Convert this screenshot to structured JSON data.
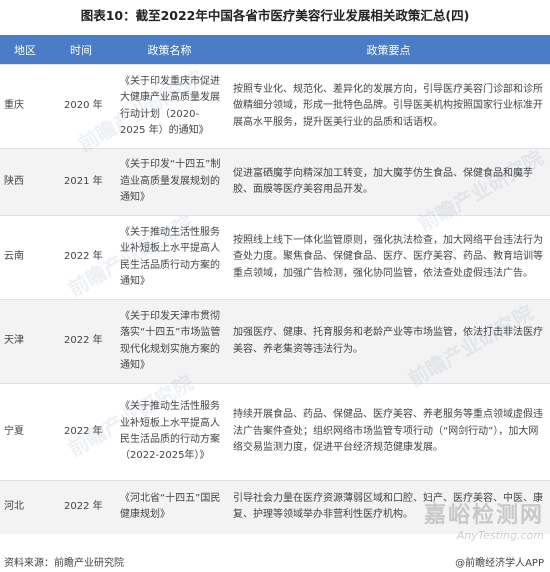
{
  "title": "图表10：截至2022年中国各省市医疗美容行业发展相关政策汇总(四)",
  "table": {
    "headers": [
      "地区",
      "时间",
      "政策名称",
      "政策要点"
    ],
    "rows": [
      {
        "region": "重庆",
        "year": "2020 年",
        "policy": "《关于印发重庆市促进大健康产业高质量发展行动计划（2020-2025 年）的通知》",
        "points": "按照专业化、规范化、差异化的发展方向，引导医疗美容门诊部和诊所做精细分领域，形成一批特色品牌。引导医美机构按照国家行业标准开展高水平服务，提升医美行业的品质和话语权。"
      },
      {
        "region": "陕西",
        "year": "2021 年",
        "policy": "《关于印发“十四五”制造业高质量发展规划的通知》",
        "points": "促进富硒魔芋向精深加工转变，加大魔芋仿生食品、保健食品和魔芋胶、面膜等医疗美容用品开发。"
      },
      {
        "region": "云南",
        "year": "2022 年",
        "policy": "《关于推动生活性服务业补短板上水平提高人民生活品质行动方案的通知》",
        "points": "按照线上线下一体化监管原则，强化执法检查，加大网络平台违法行为查处力度。聚焦食品、保健食品、医疗、医疗美容、药品、教育培训等重点领域，加强广告检测，强化协同监管，依法查处虚假违法广告。"
      },
      {
        "region": "天津",
        "year": "2022 年",
        "policy": "《关于印发天津市贯彻落实“十四五”市场监管现代化规划实施方案的通知》",
        "points": "加强医疗、健康、托育服务和老龄产业等市场监管，依法打击非法医疗美容、养老集资等违法行为。"
      },
      {
        "region": "宁夏",
        "year": "2022 年",
        "policy": "《关于推动生活性服务业补短板上水平提高人民生活品质的行动方案（2022-2025年）》",
        "points": "持续开展食品、药品、保健品、医疗美容、养老服务等重点领域虚假违法广告案件查处；组织网络市场监管专项行动（“网剑行动”），加大网络交易监测力度，促进平台经济规范健康发展。"
      },
      {
        "region": "河北",
        "year": "2022 年",
        "policy": "《河北省“十四五”国民健康规划》",
        "points": "引导社会力量在医疗资源薄弱区域和口腔、妇产、医疗美容、中医、康复、护理等领域举办非营利性医疗机构。"
      }
    ]
  },
  "footer": {
    "source": "资料来源：前瞻产业研究院",
    "brand": "@前瞻经济学人APP"
  },
  "watermark": {
    "text": "前瞻产业研究院",
    "site_cn": "嘉峪检测网",
    "site_en": "AnyTesting.com"
  }
}
